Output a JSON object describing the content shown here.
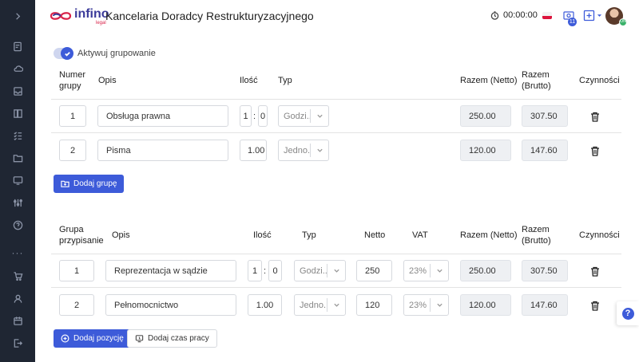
{
  "header": {
    "logo_text": "infino",
    "logo_sub": "legal",
    "title": "Kancelaria Doradcy Restrukturyzacyjnego",
    "timer": "00:00:00",
    "notification_count": "11",
    "avatar_status": "ON"
  },
  "grouping": {
    "toggle_label": "Aktywuj grupowanie",
    "enabled": true
  },
  "groups_table": {
    "headers": {
      "number": "Numer grupy",
      "desc": "Opis",
      "qty": "Ilość",
      "type": "Typ",
      "net": "Razem (Netto)",
      "gross": "Razem (Brutto)",
      "actions": "Czynności"
    },
    "rows": [
      {
        "number": "1",
        "desc": "Obsługa prawna",
        "qty_h": "1",
        "qty_m": "0",
        "type": "Godzi...",
        "net": "250.00",
        "gross": "307.50"
      },
      {
        "number": "2",
        "desc": "Pisma",
        "qty": "1.00",
        "type": "Jedno...",
        "net": "120.00",
        "gross": "147.60"
      }
    ],
    "add_button": "Dodaj grupę"
  },
  "items_table": {
    "headers": {
      "group": "Grupa przypisanie",
      "desc": "Opis",
      "qty": "Ilość",
      "type": "Typ",
      "netto": "Netto",
      "vat": "VAT",
      "net": "Razem (Netto)",
      "gross": "Razem (Brutto)",
      "actions": "Czynności"
    },
    "rows": [
      {
        "group": "1",
        "desc": "Reprezentacja w sądzie",
        "qty_h": "1",
        "qty_m": "0",
        "type": "Godzi...",
        "netto": "250",
        "vat": "23%",
        "net": "250.00",
        "gross": "307.50"
      },
      {
        "group": "2",
        "desc": "Pełnomocnictwo",
        "qty": "1.00",
        "type": "Jedno...",
        "netto": "120",
        "vat": "23%",
        "net": "120.00",
        "gross": "147.60"
      }
    ],
    "add_button": "Dodaj pozycję",
    "add_time_button": "Dodaj czas pracy"
  },
  "help": {
    "label": "?"
  },
  "colors": {
    "accent": "#3d5bd9",
    "sidebar": "#1f2633",
    "readonly": "#eef0f3"
  }
}
